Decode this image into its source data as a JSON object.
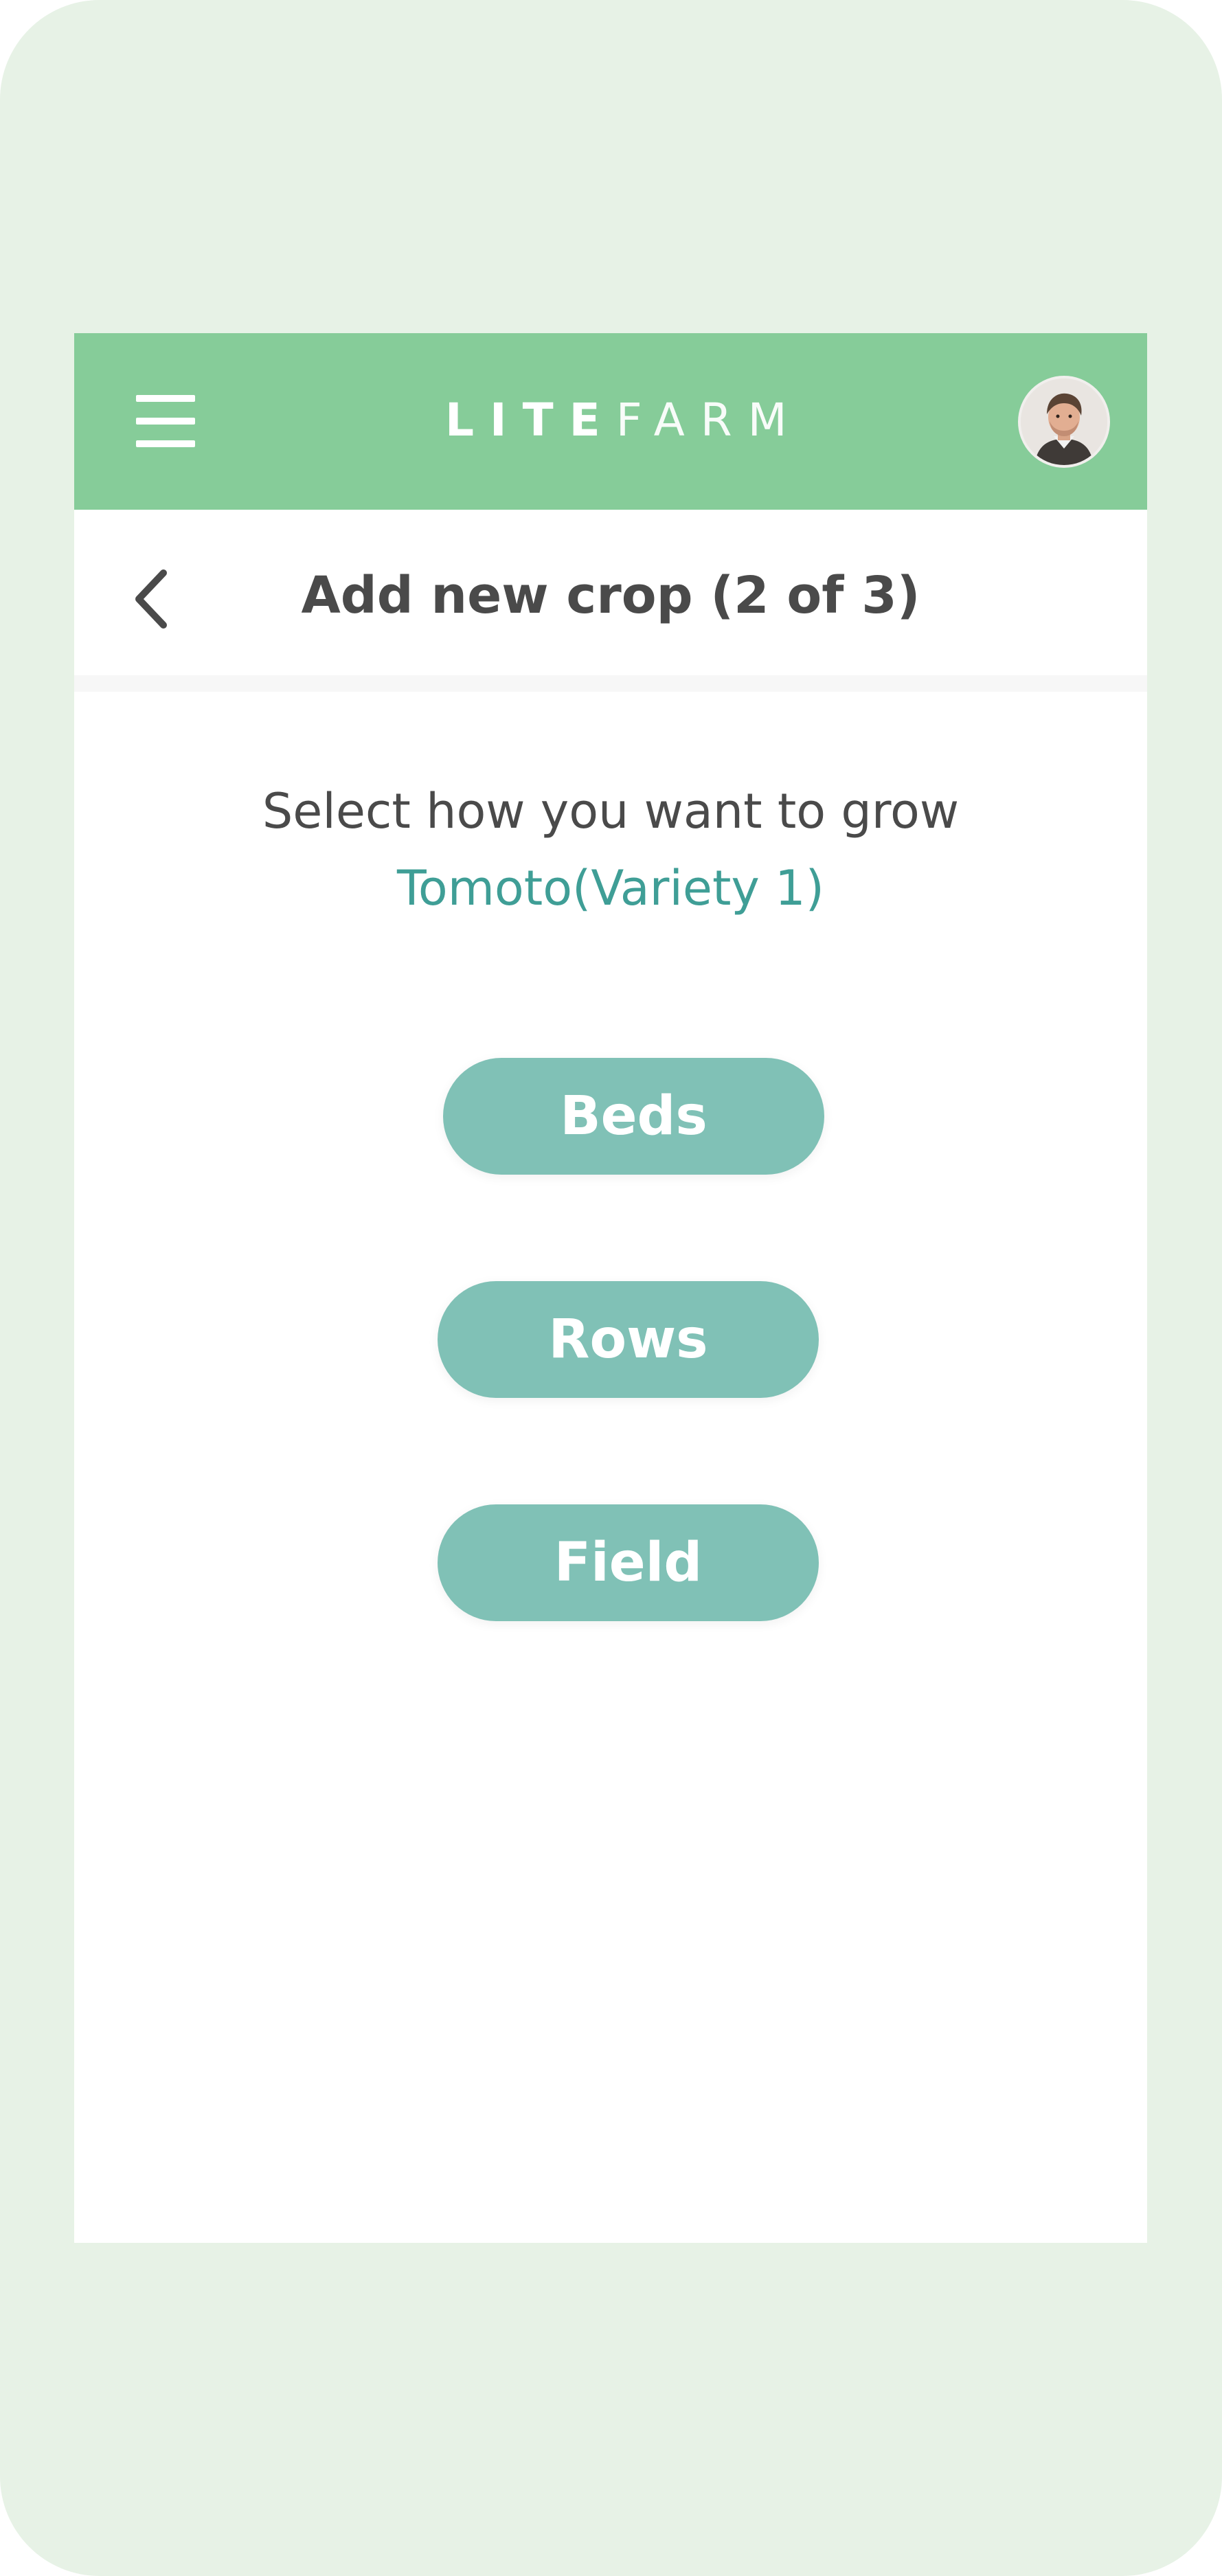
{
  "app": {
    "brand_bold": "LITE",
    "brand_light": "FARM"
  },
  "colors": {
    "background": "#e7f2e6",
    "topbar": "#86cc99",
    "accent_text": "#3f9e96",
    "button": "#80c1b6",
    "title_text": "#4a4a4a"
  },
  "icons": {
    "menu": "hamburger-menu-icon",
    "back": "chevron-left-icon",
    "avatar": "user-avatar"
  },
  "header": {
    "title": "Add new crop (2 of 3)"
  },
  "main": {
    "prompt": "Select how you want to grow",
    "crop_name": "Tomoto(Variety 1)",
    "options": [
      {
        "label": "Beds"
      },
      {
        "label": "Rows"
      },
      {
        "label": "Field"
      }
    ]
  }
}
